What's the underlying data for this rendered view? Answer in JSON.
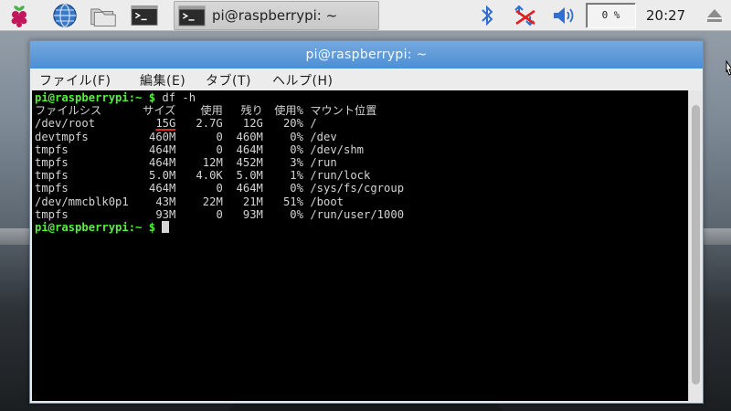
{
  "taskbar": {
    "task_label": "pi@raspberrypi: ~",
    "cpu": "0 %",
    "clock": "20:27",
    "icons": [
      "raspberry-pi-logo",
      "web-browser",
      "file-manager",
      "terminal",
      "bluetooth",
      "network-disconnected",
      "volume",
      "eject"
    ]
  },
  "window": {
    "title": "pi@raspberrypi: ~",
    "menu": [
      "ファイル(F)",
      "編集(E)",
      "タブ(T)",
      "ヘルプ(H)"
    ]
  },
  "terminal": {
    "prompt": "pi@raspberrypi:~ $",
    "command": "df -h",
    "header": {
      "fs": "ファイルシス",
      "size": "サイズ",
      "used": "使用",
      "avail": "残り",
      "pct": "使用%",
      "mount": "マウント位置"
    },
    "rows": [
      {
        "fs": "/dev/root",
        "size": "15G",
        "used": "2.7G",
        "avail": "12G",
        "pct": "20%",
        "mount": "/"
      },
      {
        "fs": "devtmpfs",
        "size": "460M",
        "used": "0",
        "avail": "460M",
        "pct": "0%",
        "mount": "/dev"
      },
      {
        "fs": "tmpfs",
        "size": "464M",
        "used": "0",
        "avail": "464M",
        "pct": "0%",
        "mount": "/dev/shm"
      },
      {
        "fs": "tmpfs",
        "size": "464M",
        "used": "12M",
        "avail": "452M",
        "pct": "3%",
        "mount": "/run"
      },
      {
        "fs": "tmpfs",
        "size": "5.0M",
        "used": "4.0K",
        "avail": "5.0M",
        "pct": "1%",
        "mount": "/run/lock"
      },
      {
        "fs": "tmpfs",
        "size": "464M",
        "used": "0",
        "avail": "464M",
        "pct": "0%",
        "mount": "/sys/fs/cgroup"
      },
      {
        "fs": "/dev/mmcblk0p1",
        "size": "43M",
        "used": "22M",
        "avail": "21M",
        "pct": "51%",
        "mount": "/boot"
      },
      {
        "fs": "tmpfs",
        "size": "93M",
        "used": "0",
        "avail": "93M",
        "pct": "0%",
        "mount": "/run/user/1000"
      }
    ],
    "highlight_color": "#e02a2a"
  }
}
